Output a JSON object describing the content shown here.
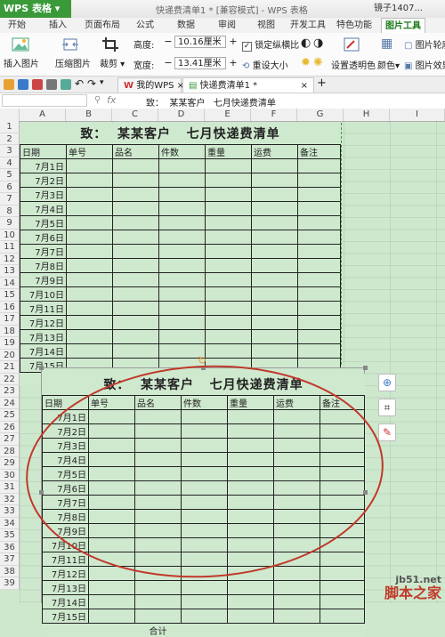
{
  "app": {
    "name": "WPS 表格",
    "window_title": "快递费清单1 * [兼容模式] - WPS 表格",
    "user": "镜子1407..."
  },
  "menu": [
    "开始",
    "插入",
    "页面布局",
    "公式",
    "数据",
    "审阅",
    "视图",
    "开发工具",
    "特色功能",
    "图片工具"
  ],
  "active_menu": "图片工具",
  "ribbon": {
    "insert_picture": "插入图片",
    "compress_picture": "压缩图片",
    "crop": "裁剪",
    "height_label": "高度:",
    "height_value": "10.16厘米",
    "width_label": "宽度:",
    "width_value": "13.41厘米",
    "lock_ratio": "锁定纵横比",
    "reset_size": "重设大小",
    "set_transparent": "设置透明色",
    "color": "颜色",
    "picture_outline": "图片轮廓",
    "picture_effect": "图片效果"
  },
  "tabs": [
    {
      "label": "我的WPS"
    },
    {
      "label": "快递费清单1 *"
    }
  ],
  "formula_bar": {
    "fx": "fx",
    "content": "致：  某某客户   七月快递费清单"
  },
  "columns": [
    "A",
    "B",
    "C",
    "D",
    "E",
    "F",
    "G",
    "H",
    "I"
  ],
  "rows": [
    "1",
    "2",
    "3",
    "4",
    "5",
    "6",
    "7",
    "8",
    "9",
    "10",
    "11",
    "12",
    "13",
    "14",
    "15",
    "16",
    "17",
    "18",
    "19",
    "20",
    "21",
    "22",
    "23",
    "24",
    "25",
    "26",
    "27",
    "28",
    "29",
    "30",
    "31",
    "32",
    "33",
    "34",
    "35",
    "36",
    "37",
    "38",
    "39"
  ],
  "sheet": {
    "title": "致：  某某客户   七月快递费清单",
    "headers": [
      "日期",
      "单号",
      "品名",
      "件数",
      "重量",
      "运费",
      "备注"
    ],
    "dates": [
      "7月1日",
      "7月2日",
      "7月3日",
      "7月4日",
      "7月5日",
      "7月6日",
      "7月7日",
      "7月8日",
      "7月9日",
      "7月10日",
      "7月11日",
      "7月12日",
      "7月13日",
      "7月14日",
      "7月15日"
    ],
    "total_label": "合计"
  },
  "watermark": {
    "line1": "jb51.net",
    "line2": "脚本之家"
  },
  "colors": {
    "brand": "#3a9a3a",
    "sheet_bg": "#cde8cd",
    "highlight_ellipse": "#c0392b"
  }
}
